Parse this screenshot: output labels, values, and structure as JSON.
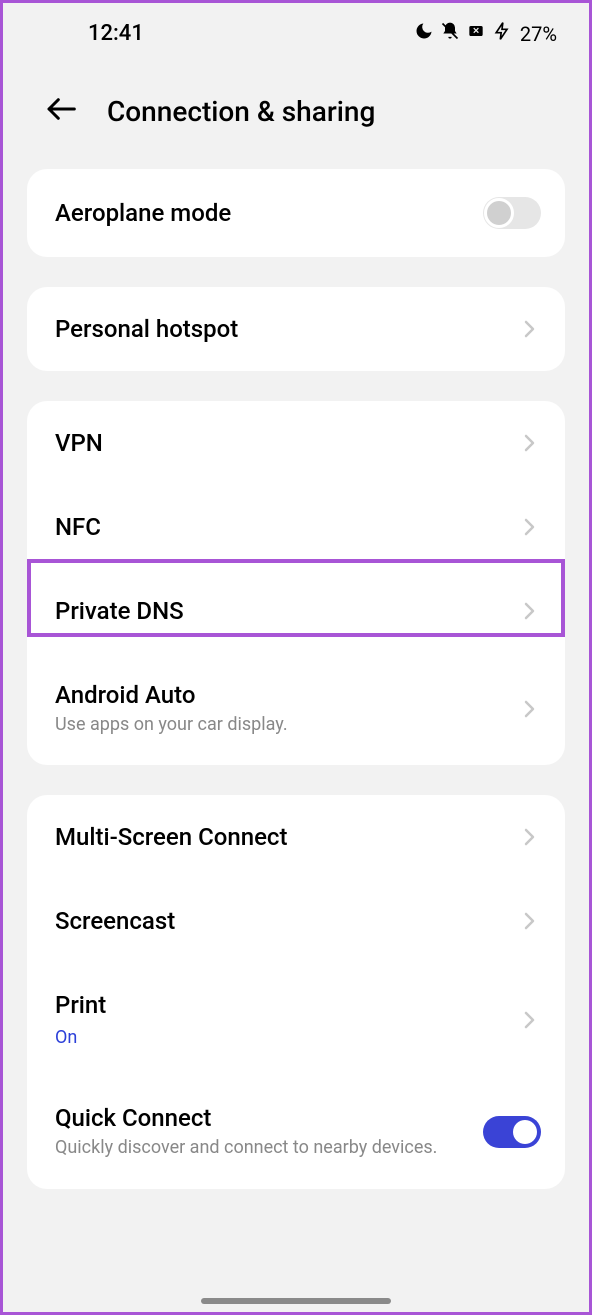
{
  "status": {
    "time": "12:41",
    "battery": "27%"
  },
  "header": {
    "title": "Connection & sharing"
  },
  "group1": {
    "aeroplane": {
      "label": "Aeroplane mode"
    }
  },
  "group2": {
    "hotspot": {
      "label": "Personal hotspot"
    }
  },
  "group3": {
    "vpn": {
      "label": "VPN"
    },
    "nfc": {
      "label": "NFC"
    },
    "privatedns": {
      "label": "Private DNS"
    },
    "androidauto": {
      "label": "Android Auto",
      "sublabel": "Use apps on your car display."
    }
  },
  "group4": {
    "multiscreen": {
      "label": "Multi-Screen Connect"
    },
    "screencast": {
      "label": "Screencast"
    },
    "print": {
      "label": "Print",
      "status": "On"
    },
    "quickconnect": {
      "label": "Quick Connect",
      "sublabel": "Quickly discover and connect to nearby devices."
    }
  }
}
